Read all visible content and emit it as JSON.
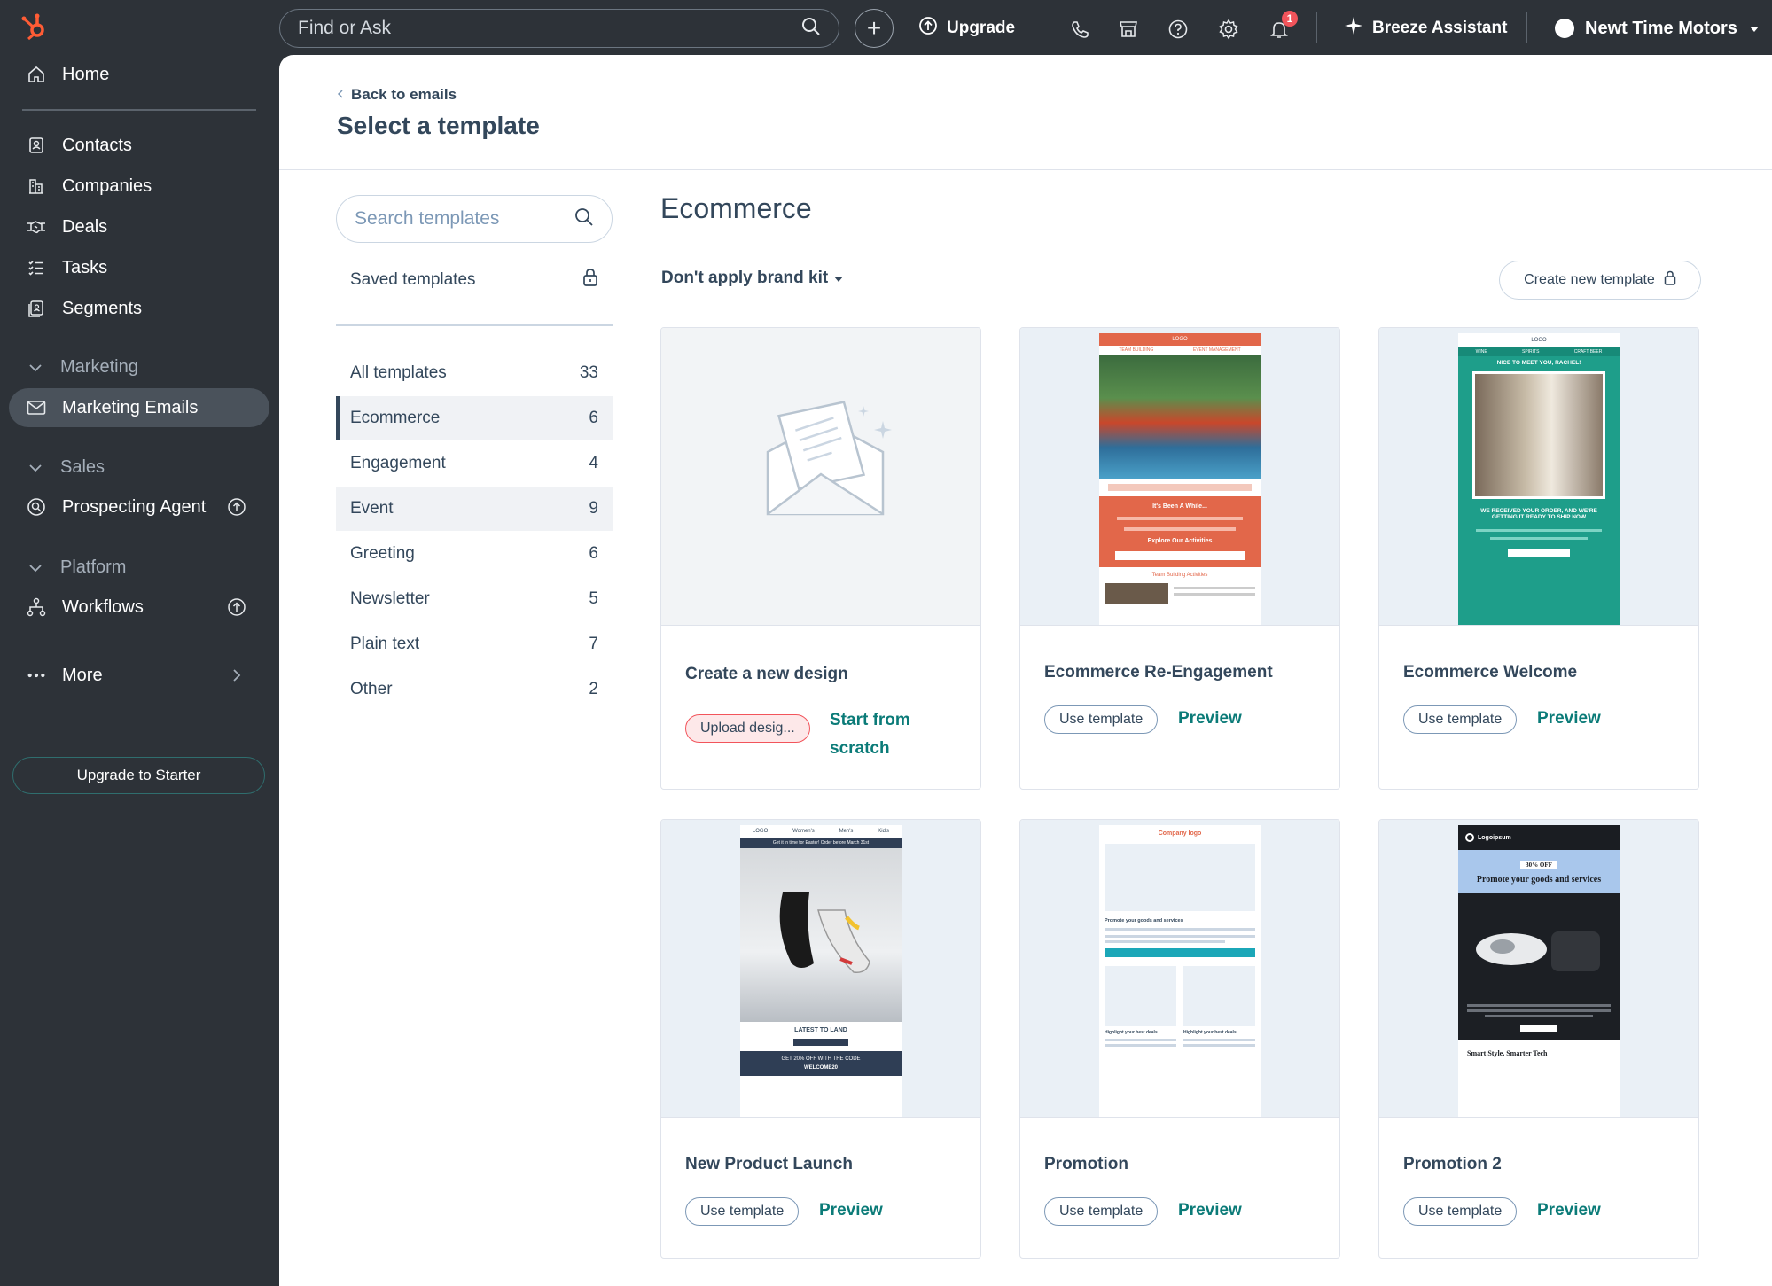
{
  "topbar": {
    "search_placeholder": "Find or Ask",
    "upgrade_label": "Upgrade",
    "notification_count": "1",
    "assistant_label": "Breeze Assistant",
    "account_name": "Newt Time Motors"
  },
  "sidebar": {
    "home": "Home",
    "contacts": "Contacts",
    "companies": "Companies",
    "deals": "Deals",
    "tasks": "Tasks",
    "segments": "Segments",
    "marketing_section": "Marketing",
    "marketing_emails": "Marketing Emails",
    "sales_section": "Sales",
    "prospecting_agent": "Prospecting Agent",
    "platform_section": "Platform",
    "workflows": "Workflows",
    "more": "More",
    "upgrade_starter": "Upgrade to Starter"
  },
  "header": {
    "back_link": "Back to emails",
    "title": "Select a template"
  },
  "filters": {
    "search_placeholder": "Search templates",
    "saved_templates": "Saved templates",
    "categories": [
      {
        "label": "All templates",
        "count": "33"
      },
      {
        "label": "Ecommerce",
        "count": "6"
      },
      {
        "label": "Engagement",
        "count": "4"
      },
      {
        "label": "Event",
        "count": "9"
      },
      {
        "label": "Greeting",
        "count": "6"
      },
      {
        "label": "Newsletter",
        "count": "5"
      },
      {
        "label": "Plain text",
        "count": "7"
      },
      {
        "label": "Other",
        "count": "2"
      }
    ]
  },
  "content": {
    "section_title": "Ecommerce",
    "brand_kit": "Don't apply brand kit",
    "create_new": "Create new template",
    "new_design": {
      "title": "Create a new design",
      "upload": "Upload desig...",
      "start_from": "Start from",
      "scratch": "scratch"
    },
    "use_template": "Use template",
    "preview": "Preview",
    "cards": [
      {
        "title": "Ecommerce Re-Engagement"
      },
      {
        "title": "Ecommerce Welcome"
      },
      {
        "title": "New Product Launch"
      },
      {
        "title": "Promotion"
      },
      {
        "title": "Promotion 2"
      }
    ],
    "thumbs": {
      "re_engagement": {
        "header": "LOGO",
        "nav1": "TEAM BUILDING",
        "nav2": "EVENT MANAGEMENT",
        "heading": "It's Been A While...",
        "cta": "Explore Our Activities",
        "footer": "Team Building Activities"
      },
      "welcome": {
        "header": "LOGO",
        "nav1": "WINE",
        "nav2": "SPIRITS",
        "nav3": "CRAFT BEER",
        "greeting": "NICE TO MEET YOU, RACHEL!",
        "message": "WE RECEIVED YOUR ORDER, AND WE'RE GETTING IT READY TO SHIP NOW"
      },
      "launch": {
        "header": "LOGO",
        "nav1": "Women's",
        "nav2": "Men's",
        "nav3": "Kid's",
        "banner": "Get it in time for Easter! Order before March 31st",
        "latest": "LATEST TO LAND",
        "offer": "GET 20% OFF WITH THE CODE",
        "code": "WELCOME20"
      },
      "promotion": {
        "logo": "Company logo",
        "headline": "Promote your goods and services",
        "highlight1": "Highlight your best deals",
        "highlight2": "Highlight your best deals"
      },
      "promotion2": {
        "brand": "Logoipsum",
        "badge": "30% OFF",
        "headline": "Promote your goods and services",
        "footer": "Smart Style, Smarter Tech"
      }
    }
  },
  "colors": {
    "sidebar_bg": "#2d3238",
    "accent_teal": "#0b7b78",
    "brand_orange": "#ff5c35",
    "text_primary": "#33475b"
  }
}
